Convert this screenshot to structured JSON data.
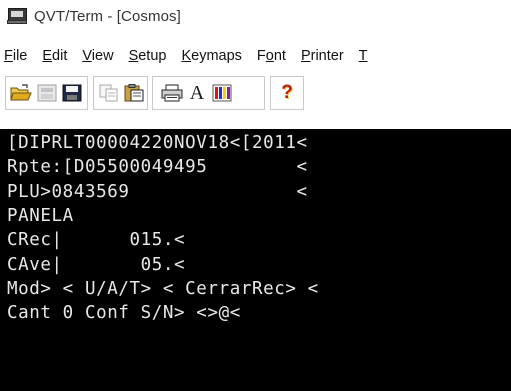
{
  "window": {
    "title": "QVT/Term - [Cosmos]"
  },
  "menu": {
    "items": [
      {
        "id": "file",
        "label": "File",
        "accel_index": 0
      },
      {
        "id": "edit",
        "label": "Edit",
        "accel_index": 0
      },
      {
        "id": "view",
        "label": "View",
        "accel_index": 0
      },
      {
        "id": "setup",
        "label": "Setup",
        "accel_index": 0
      },
      {
        "id": "keymaps",
        "label": "Keymaps",
        "accel_index": 0
      },
      {
        "id": "font",
        "label": "Font",
        "accel_index": 1
      },
      {
        "id": "printer",
        "label": "Printer",
        "accel_index": 0
      },
      {
        "id": "more",
        "label": "T",
        "accel_index": 0
      }
    ]
  },
  "toolbar": {
    "buttons": [
      {
        "id": "open",
        "icon": "open-folder-icon"
      },
      {
        "id": "close",
        "icon": "close-session-icon"
      },
      {
        "id": "save",
        "icon": "floppy-disk-icon"
      },
      {
        "id": "copy",
        "icon": "copy-icon"
      },
      {
        "id": "paste",
        "icon": "paste-icon"
      },
      {
        "id": "print",
        "icon": "printer-icon"
      },
      {
        "id": "font",
        "icon": "font-A-icon",
        "text": "A"
      },
      {
        "id": "colors",
        "icon": "color-bars-icon"
      },
      {
        "id": "help",
        "icon": "help-question-icon",
        "text": "?"
      }
    ]
  },
  "terminal": {
    "lines": [
      "[DIPRLT00004220NOV18<[2011<",
      "Rpte:[D05500049495        <",
      "PLU>0843569               <",
      "PANELA",
      "CRec|      015.<",
      "CAve|       05.<",
      "Mod> < U/A/T> < CerrarRec> <",
      "Cant 0 Conf S/N> <>@<"
    ]
  }
}
